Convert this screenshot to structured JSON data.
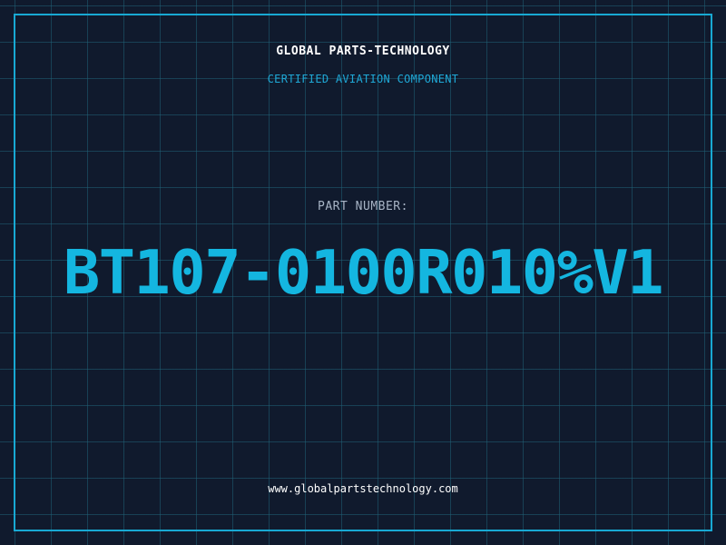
{
  "header": {
    "company": "GLOBAL PARTS-TECHNOLOGY",
    "subtitle": "CERTIFIED AVIATION COMPONENT"
  },
  "part": {
    "label": "PART NUMBER:",
    "number": "BT107-0100R010%V1"
  },
  "footer": {
    "url": "www.globalpartstechnology.com"
  },
  "colors": {
    "background": "#101a2d",
    "grid": "#206076",
    "accent": "#14b6e0",
    "border": "#18a9d3",
    "text": "#ffffff",
    "label": "#a7b4c5"
  }
}
